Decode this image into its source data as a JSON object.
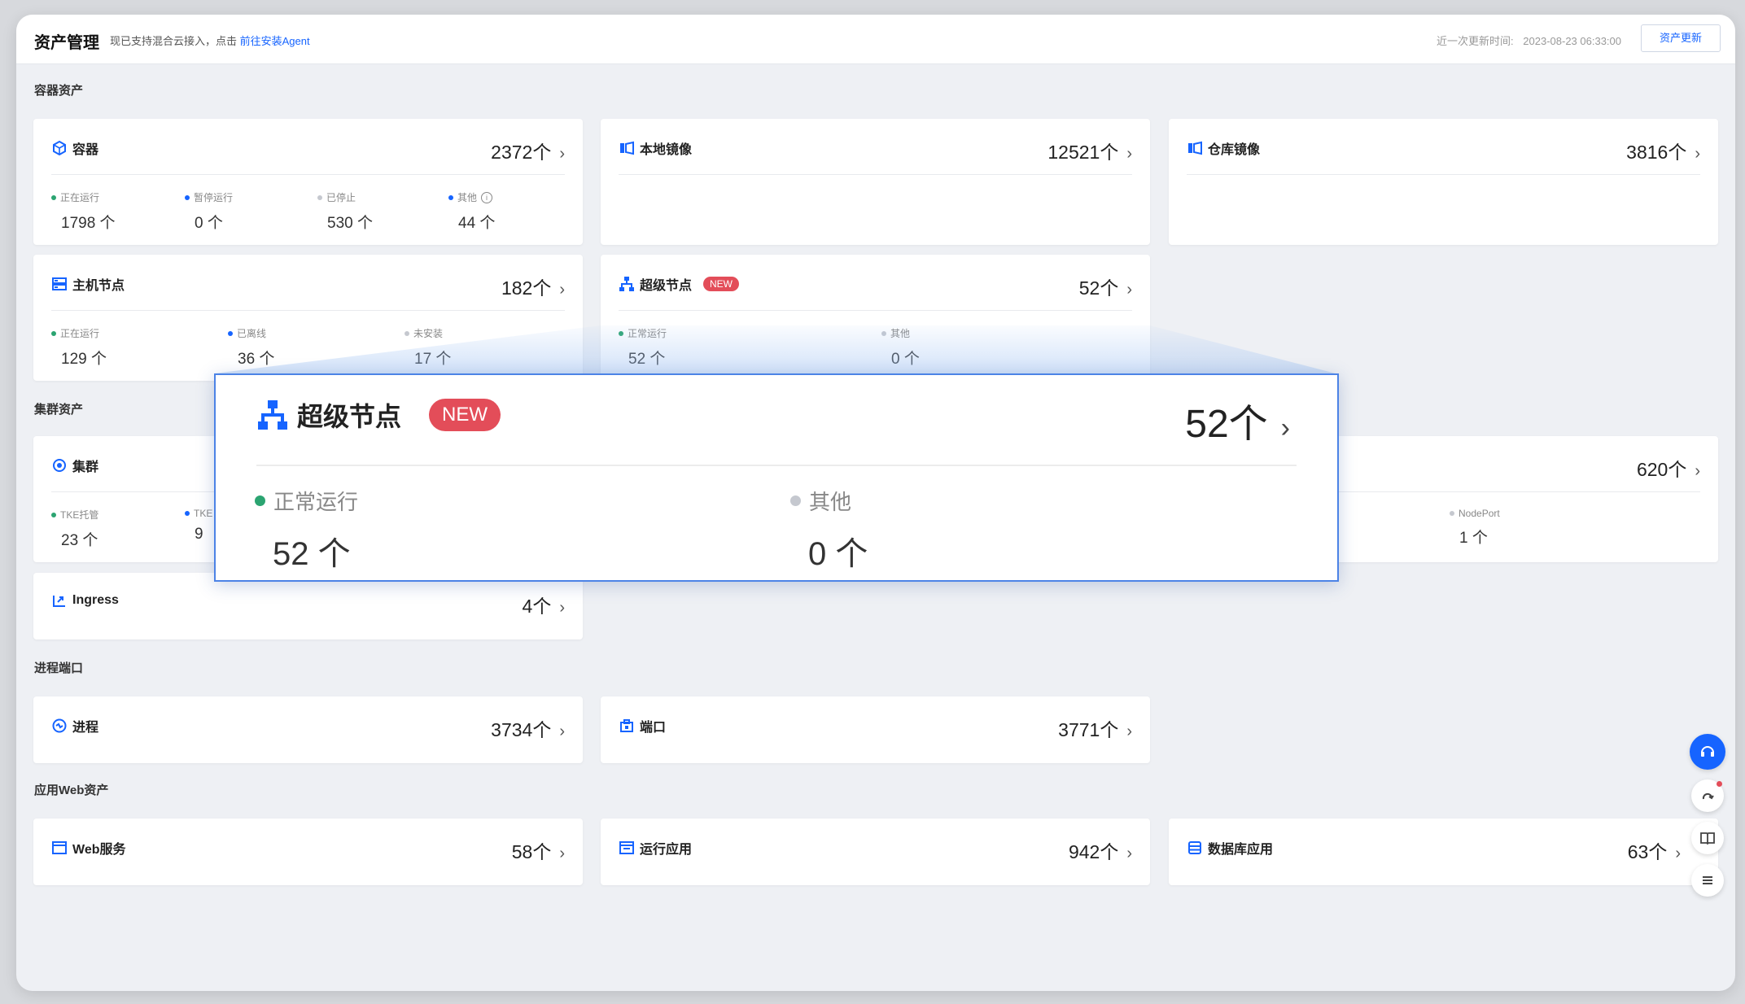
{
  "header": {
    "title": "资产管理",
    "notice_text": "现已支持混合云接入，点击",
    "notice_link": "前往安装Agent",
    "last_update_label": "近一次更新时间:",
    "last_update_time": "2023-08-23 06:33:00",
    "refresh_label": "资产更新"
  },
  "sections": {
    "container": "容器资产",
    "cluster": "集群资产",
    "process": "进程端口",
    "web": "应用Web资产"
  },
  "cards": {
    "container": {
      "name": "容器",
      "count": "2372个",
      "stats": [
        {
          "label": "正在运行",
          "value": "1798 个",
          "color": "#2ba471"
        },
        {
          "label": "暂停运行",
          "value": "0 个",
          "color": "#1664ff"
        },
        {
          "label": "已停止",
          "value": "530 个",
          "color": "#c5c8cf"
        },
        {
          "label": "其他",
          "value": "44 个",
          "color": "#1664ff"
        }
      ]
    },
    "local_image": {
      "name": "本地镜像",
      "count": "12521个"
    },
    "repo_image": {
      "name": "仓库镜像",
      "count": "3816个"
    },
    "host_node": {
      "name": "主机节点",
      "count": "182个",
      "stats": [
        {
          "label": "正在运行",
          "value": "129 个",
          "color": "#2ba471"
        },
        {
          "label": "已离线",
          "value": "36 个",
          "color": "#1664ff"
        },
        {
          "label": "未安装",
          "value": "17 个",
          "color": "#c5c8cf"
        }
      ]
    },
    "super_node": {
      "name": "超级节点",
      "badge": "NEW",
      "count": "52个",
      "stats": [
        {
          "label": "正常运行",
          "value": "52 个",
          "color": "#2ba471"
        },
        {
          "label": "其他",
          "value": "0 个",
          "color": "#c5c8cf"
        }
      ]
    },
    "cluster": {
      "name": "集群",
      "stats": [
        {
          "label": "TKE托管",
          "value": "23 个",
          "color": "#2ba471"
        },
        {
          "label": "TKE",
          "value": "9",
          "color": "#1664ff"
        }
      ]
    },
    "service": {
      "count": "620个",
      "stats": [
        {
          "label": "NodePort",
          "value": "1 个",
          "color": "#c5c8cf"
        }
      ]
    },
    "ingress": {
      "name": "Ingress",
      "count": "4个"
    },
    "process": {
      "name": "进程",
      "count": "3734个"
    },
    "port": {
      "name": "端口",
      "count": "3771个"
    },
    "web_service": {
      "name": "Web服务",
      "count": "58个"
    },
    "running_app": {
      "name": "运行应用",
      "count": "942个"
    },
    "db_app": {
      "name": "数据库应用",
      "count": "63个"
    }
  },
  "zoom": {
    "name": "超级节点",
    "badge": "NEW",
    "count": "52个",
    "stats": [
      {
        "label": "正常运行",
        "value": "52 个"
      },
      {
        "label": "其他",
        "value": "0 个"
      }
    ]
  },
  "chevron": "›",
  "colors": {
    "accent": "#1664ff",
    "running": "#2ba471",
    "muted": "#c5c8cf",
    "badge": "#e34d59"
  },
  "icons": {
    "float_1": "support-icon",
    "float_2": "cloud-refresh-icon",
    "float_3": "book-icon",
    "float_4": "list-icon"
  }
}
